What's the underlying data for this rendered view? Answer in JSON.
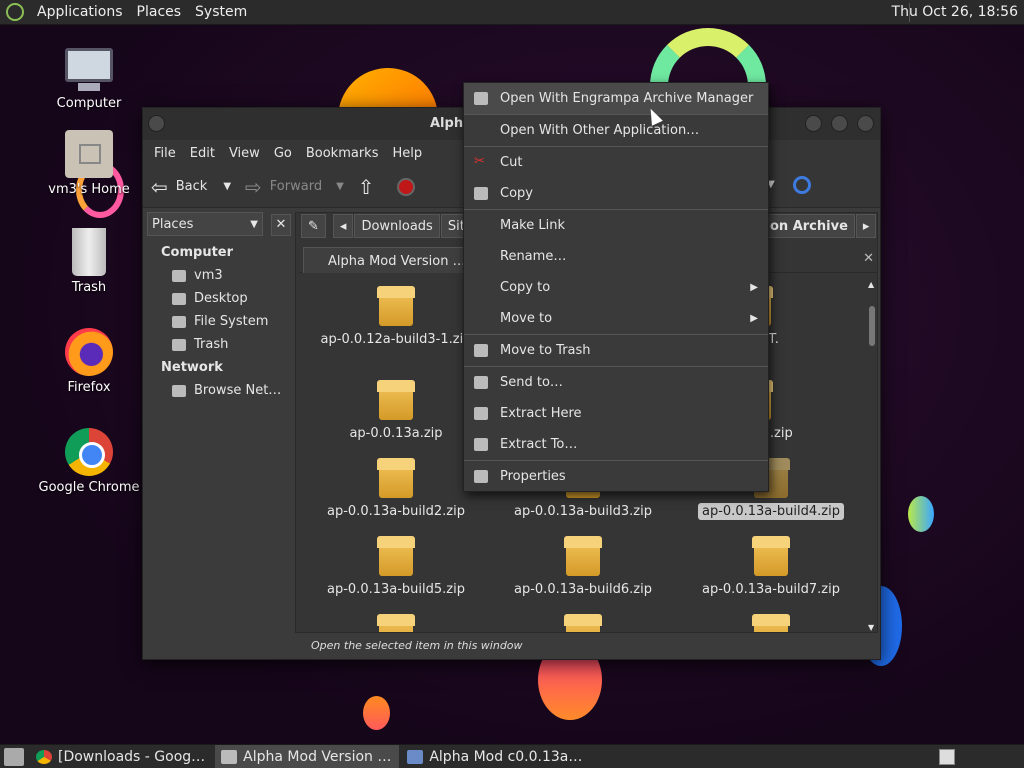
{
  "top_panel": {
    "menus": [
      "Applications",
      "Places",
      "System"
    ],
    "clock": "Thu Oct 26, 18:56"
  },
  "desktop_icons": [
    {
      "label": "Computer",
      "icon": "computer-icon"
    },
    {
      "label": "vm3's Home",
      "icon": "home-folder-icon"
    },
    {
      "label": "Trash",
      "icon": "trash-icon"
    },
    {
      "label": "Firefox",
      "icon": "firefox-icon"
    },
    {
      "label": "Google Chrome",
      "icon": "chrome-icon"
    }
  ],
  "window": {
    "title": "Alpha",
    "menubar": [
      "File",
      "Edit",
      "View",
      "Go",
      "Bookmarks",
      "Help"
    ],
    "toolbar": {
      "back": "Back",
      "forward": "Forward"
    },
    "sidebar": {
      "header": "Places",
      "close": "✕",
      "sections": [
        {
          "title": "Computer",
          "items": [
            "vm3",
            "Desktop",
            "File System",
            "Trash"
          ]
        },
        {
          "title": "Network",
          "items": [
            "Browse Net…"
          ]
        }
      ]
    },
    "pathbar": [
      "Downloads",
      "Sit",
      "on Archive"
    ],
    "tab_label": "Alpha Mod Version …",
    "files": [
      "ap-0.0.12a-build3-1.zip",
      "-MP-TEST.\nip",
      "ap-0.0.13a.zip",
      "a-build1.zip",
      "ap-0.0.13a-build2.zip",
      "ap-0.0.13a-build3.zip",
      "ap-0.0.13a-build4.zip",
      "ap-0.0.13a-build5.zip",
      "ap-0.0.13a-build6.zip",
      "ap-0.0.13a-build7.zip"
    ],
    "status": "Open the selected item in this window"
  },
  "context_menu": {
    "items": [
      {
        "label": "Open With Engrampa Archive Manager",
        "icon": "archive-manager-icon"
      },
      {
        "label": "Open With Other Application…",
        "icon": ""
      },
      {
        "label": "Cut",
        "icon": "scissors-icon"
      },
      {
        "label": "Copy",
        "icon": "copy-icon"
      },
      {
        "label": "Make Link",
        "icon": ""
      },
      {
        "label": "Rename…",
        "icon": ""
      },
      {
        "label": "Copy to",
        "icon": "",
        "submenu": true
      },
      {
        "label": "Move to",
        "icon": "",
        "submenu": true
      },
      {
        "label": "Move to Trash",
        "icon": "trash-icon"
      },
      {
        "label": "Send to…",
        "icon": "send-icon"
      },
      {
        "label": "Extract Here",
        "icon": "extract-icon"
      },
      {
        "label": "Extract To…",
        "icon": "extract-icon"
      },
      {
        "label": "Properties",
        "icon": "properties-icon"
      }
    ]
  },
  "taskbar": {
    "tasks": [
      {
        "label": "[Downloads - Goog…",
        "icon": "chrome-icon"
      },
      {
        "label": "Alpha Mod Version …",
        "icon": "folder-icon"
      },
      {
        "label": "Alpha Mod c0.0.13a…",
        "icon": "archive-icon"
      }
    ]
  }
}
